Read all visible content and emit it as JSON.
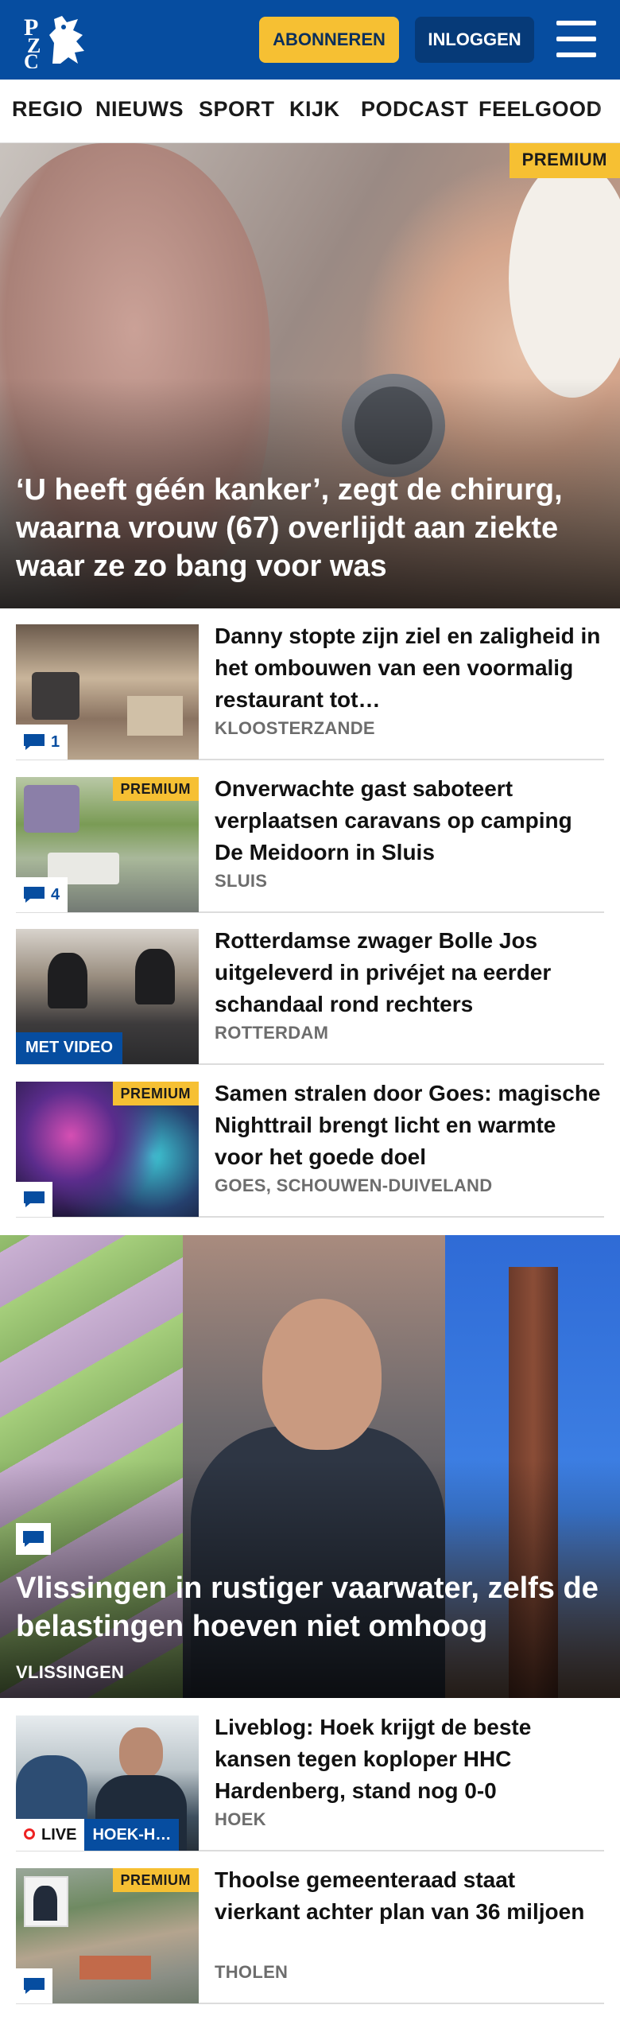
{
  "header": {
    "logo_text": "PZC",
    "subscribe_label": "ABONNEREN",
    "login_label": "INLOGGEN",
    "menu_icon": "hamburger-menu-icon",
    "brand_color": "#064da0",
    "accent_color": "#f6c033"
  },
  "nav": {
    "items": [
      "REGIO",
      "NIEUWS",
      "SPORT",
      "KIJK",
      "PODCAST",
      "FEELGOOD"
    ]
  },
  "hero": {
    "badge": "PREMIUM",
    "title": "‘U heeft géén kanker’, zegt de chirurg, waarna vrouw (67) overlijdt aan ziekte waar ze zo bang voor was"
  },
  "articles_top": [
    {
      "title": "Danny stopte zijn ziel en zaligheid in het ombouwen van een voormalig restaurant tot…",
      "location": "KLOOSTERZANDE",
      "comments": "1"
    },
    {
      "badge": "PREMIUM",
      "title": "Onverwachte gast saboteert verplaatsen caravans op camping De Meidoorn in Sluis",
      "location": "SLUIS",
      "comments": "4"
    },
    {
      "video_label": "MET VIDEO",
      "title": "Rotterdamse zwager Bolle Jos uitgeleverd in privéjet na eerder schandaal rond rechters",
      "location": "ROTTERDAM"
    },
    {
      "badge": "PREMIUM",
      "title": "Samen stralen door Goes: magische Nighttrail brengt licht en warmte voor het goede doel",
      "location": "GOES, SCHOUWEN-DUIVELAND"
    }
  ],
  "big_story": {
    "title": "Vlissingen in rustiger vaarwater, zelfs de belastingen hoeven niet omhoog",
    "location": "VLISSINGEN"
  },
  "articles_bottom": [
    {
      "live_label": "LIVE",
      "live_tag": "HOEK-H…",
      "title": "Liveblog: Hoek krijgt de beste kansen tegen koploper HHC Hardenberg, stand nog 0-0",
      "location": "HOEK"
    },
    {
      "badge": "PREMIUM",
      "title": "Thoolse gemeenteraad staat vierkant achter plan van 36 miljoen",
      "location": "THOLEN"
    }
  ]
}
